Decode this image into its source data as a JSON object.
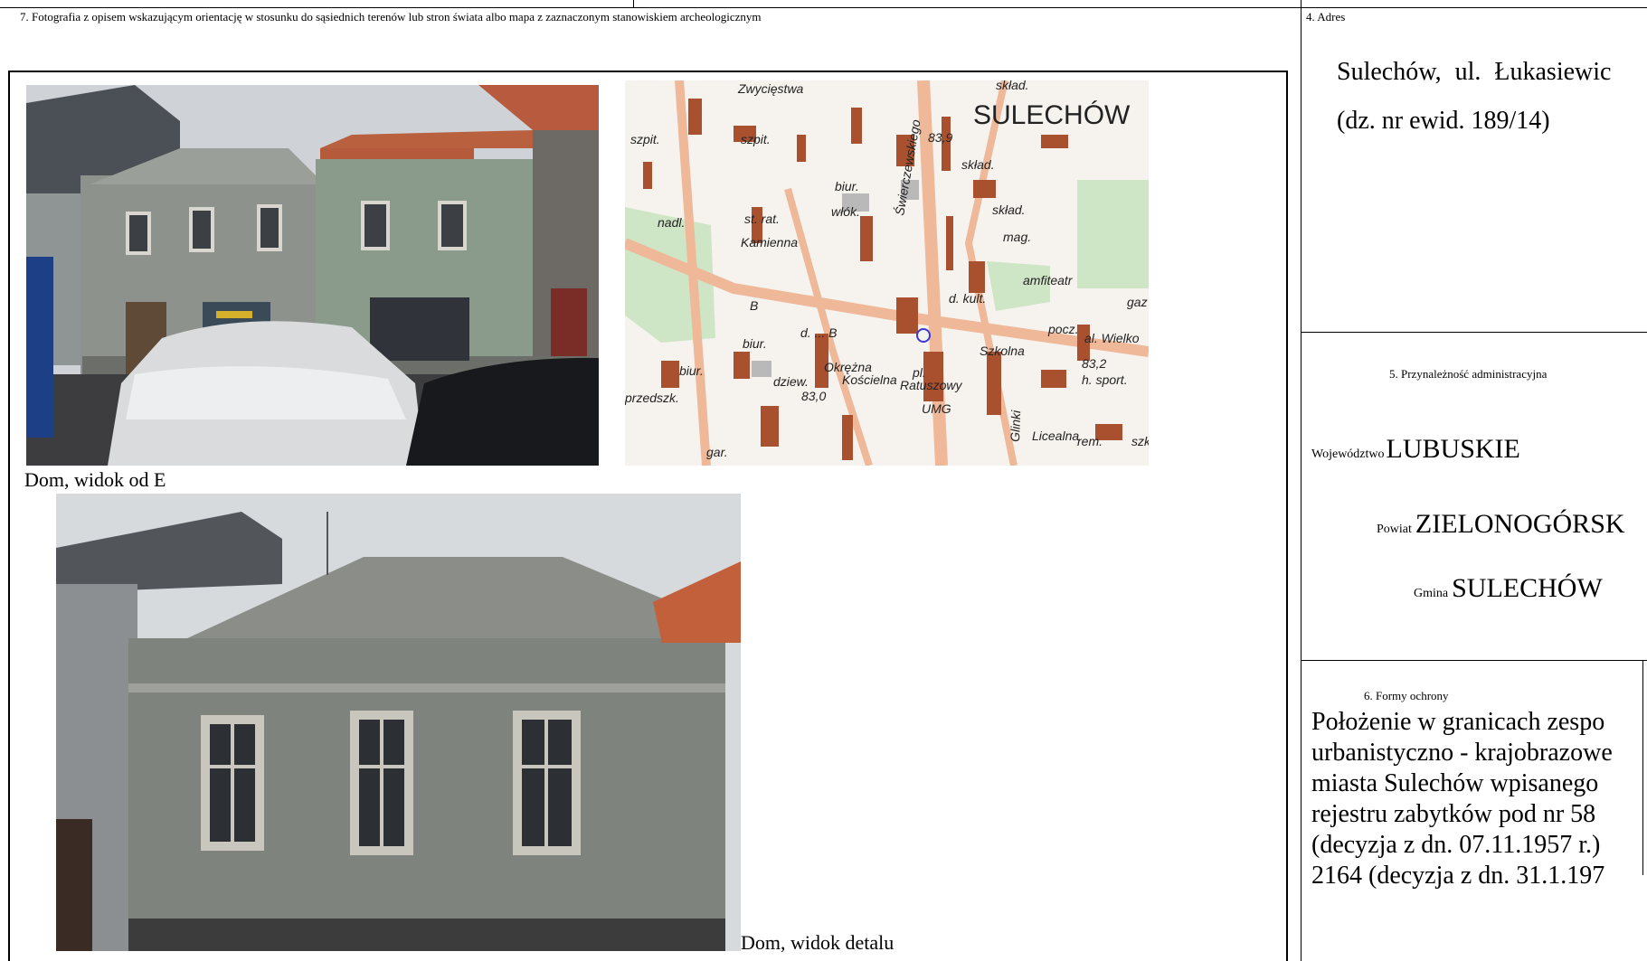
{
  "left_panel": {
    "section_label": "7. Fotografia z opisem wskazującym orientację w stosunku do sąsiednich terenów lub stron świata albo mapa z zaznaczonym stanowiskiem archeologicznym",
    "photo1_caption": "Dom, widok od E",
    "photo2_caption": "Dom, widok detalu",
    "map": {
      "town": "SULECHÓW",
      "labels": [
        "Zwycięstwa",
        "skład.",
        "szpit.",
        "szpit.",
        "83,9",
        "skład.",
        "biur.",
        "włók.",
        "skład.",
        "st. rat.",
        "nadl.",
        "Kamienna",
        "mag.",
        "amfiteatr",
        "d. kult.",
        "gaz",
        "pocz.",
        "B",
        "d. ... B",
        "Okrężna",
        "Kościelna",
        "al. Wielko",
        "biur.",
        "dziew.",
        "Szkolna",
        "83,2",
        "h. sport.",
        "biur.",
        "83,0",
        "pl. Ratuszowy",
        "UMG",
        "przedszk.",
        "Licealna",
        "rem.",
        "szk",
        "gar.",
        "Świerczewskiego",
        "Glinki"
      ]
    }
  },
  "right_panel": {
    "address_label": "4. Adres",
    "address_line1": "Sulechów, ul. Łukasiewic",
    "address_line2": "(dz. nr ewid. 189/14)",
    "admin_label": "5. Przynależność administracyjna",
    "voivodeship_label": "Województwo",
    "voivodeship_value": "LUBUSKIE",
    "county_label": "Powiat",
    "county_value": "ZIELONOGÓRSK",
    "commune_label": "Gmina",
    "commune_value": "SULECHÓW",
    "protection_label": "6. Formy ochrony",
    "protection_lines": [
      "Położenie w granicach zespo",
      "urbanistyczno - krajobrazowe",
      "miasta Sulechów wpisanego",
      "rejestru zabytków pod nr 58",
      "(decyzja z dn. 07.11.1957 r.)",
      "2164 (decyzja z dn. 31.1.197"
    ]
  }
}
